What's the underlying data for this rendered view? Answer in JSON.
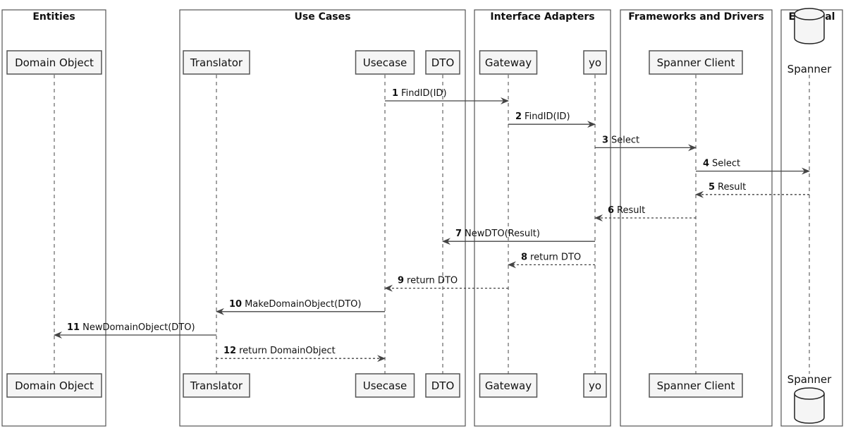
{
  "groups": [
    {
      "title": "Entities"
    },
    {
      "title": "Use Cases"
    },
    {
      "title": "Interface Adapters"
    },
    {
      "title": "Frameworks and Drivers"
    },
    {
      "title": "External"
    }
  ],
  "participants": [
    {
      "name": "Domain Object",
      "shape": "box"
    },
    {
      "name": "Translator",
      "shape": "box"
    },
    {
      "name": "Usecase",
      "shape": "box"
    },
    {
      "name": "DTO",
      "shape": "box"
    },
    {
      "name": "Gateway",
      "shape": "box"
    },
    {
      "name": "yo",
      "shape": "box"
    },
    {
      "name": "Spanner Client",
      "shape": "box"
    },
    {
      "name": "Spanner",
      "shape": "database"
    }
  ],
  "messages": [
    {
      "num": "1",
      "label": "FindID(ID)",
      "from": 2,
      "to": 4,
      "style": "solid"
    },
    {
      "num": "2",
      "label": "FindID(ID)",
      "from": 4,
      "to": 5,
      "style": "solid"
    },
    {
      "num": "3",
      "label": "Select",
      "from": 5,
      "to": 6,
      "style": "solid"
    },
    {
      "num": "4",
      "label": "Select",
      "from": 6,
      "to": 7,
      "style": "solid"
    },
    {
      "num": "5",
      "label": "Result",
      "from": 7,
      "to": 6,
      "style": "dashed"
    },
    {
      "num": "6",
      "label": "Result",
      "from": 6,
      "to": 5,
      "style": "dashed"
    },
    {
      "num": "7",
      "label": "NewDTO(Result)",
      "from": 5,
      "to": 3,
      "style": "solid"
    },
    {
      "num": "8",
      "label": "return DTO",
      "from": 5,
      "to": 4,
      "style": "dashed"
    },
    {
      "num": "9",
      "label": "return DTO",
      "from": 4,
      "to": 2,
      "style": "dashed"
    },
    {
      "num": "10",
      "label": "MakeDomainObject(DTO)",
      "from": 2,
      "to": 1,
      "style": "solid"
    },
    {
      "num": "11",
      "label": "NewDomainObject(DTO)",
      "from": 1,
      "to": 0,
      "style": "solid"
    },
    {
      "num": "12",
      "label": "return DomainObject",
      "from": 1,
      "to": 2,
      "style": "dashed"
    }
  ],
  "colors": {
    "line": "#444444",
    "box_fill": "#f5f5f5",
    "border": "#555555"
  }
}
